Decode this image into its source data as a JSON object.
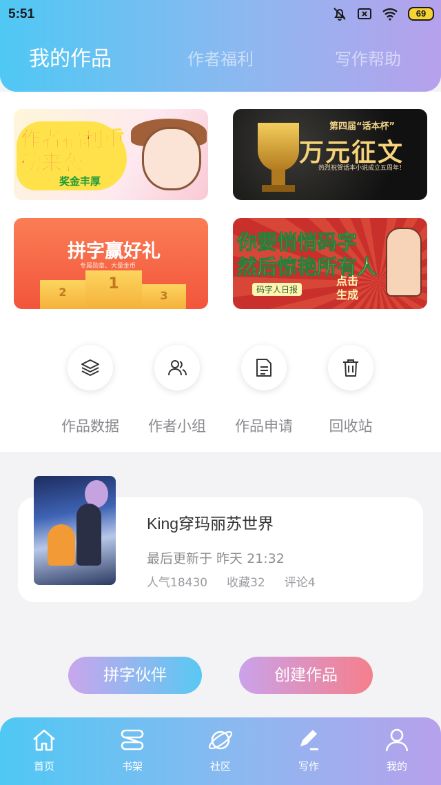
{
  "status_bar": {
    "time": "5:51",
    "battery": "69"
  },
  "tabs": [
    {
      "label": "我的作品",
      "active": true
    },
    {
      "label": "作者福利",
      "active": false
    },
    {
      "label": "写作帮助",
      "active": false
    }
  ],
  "banners": {
    "welfare": {
      "title": "作者福利重磅来袭",
      "badge": "奖金丰厚"
    },
    "contest": {
      "small": "第四届“话本杯”",
      "title": "万元征文",
      "sub": "热烈祝贺话本小说成立五周年！"
    },
    "pinzi": {
      "title": "拼字赢好礼",
      "sub": "专属勋章、大量金币",
      "podium": [
        "1",
        "2",
        "3"
      ]
    },
    "typing": {
      "line1": "你要悄悄码字",
      "line2": "然后惊艳所有人",
      "tag": "码字人日报",
      "click": "点击生成"
    }
  },
  "actions": [
    {
      "label": "作品数据",
      "icon": "layers-icon"
    },
    {
      "label": "作者小组",
      "icon": "group-icon"
    },
    {
      "label": "作品申请",
      "icon": "document-icon"
    },
    {
      "label": "回收站",
      "icon": "trash-icon"
    }
  ],
  "work": {
    "title": "King穿玛丽苏世界",
    "updated": "最后更新于 昨天 21:32",
    "popularity": "人气18430",
    "favorites": "收藏32",
    "comments": "评论4"
  },
  "buttons": {
    "partner": "拼字伙伴",
    "create": "创建作品"
  },
  "nav": [
    {
      "label": "首页",
      "icon": "home-icon"
    },
    {
      "label": "书架",
      "icon": "bookshelf-icon"
    },
    {
      "label": "社区",
      "icon": "planet-icon"
    },
    {
      "label": "写作",
      "icon": "pen-icon",
      "active": true
    },
    {
      "label": "我的",
      "icon": "profile-icon"
    }
  ],
  "colors": {
    "header_start": "#4fc8f4",
    "header_end": "#b7a1ec",
    "create_end": "#f57f8c"
  }
}
